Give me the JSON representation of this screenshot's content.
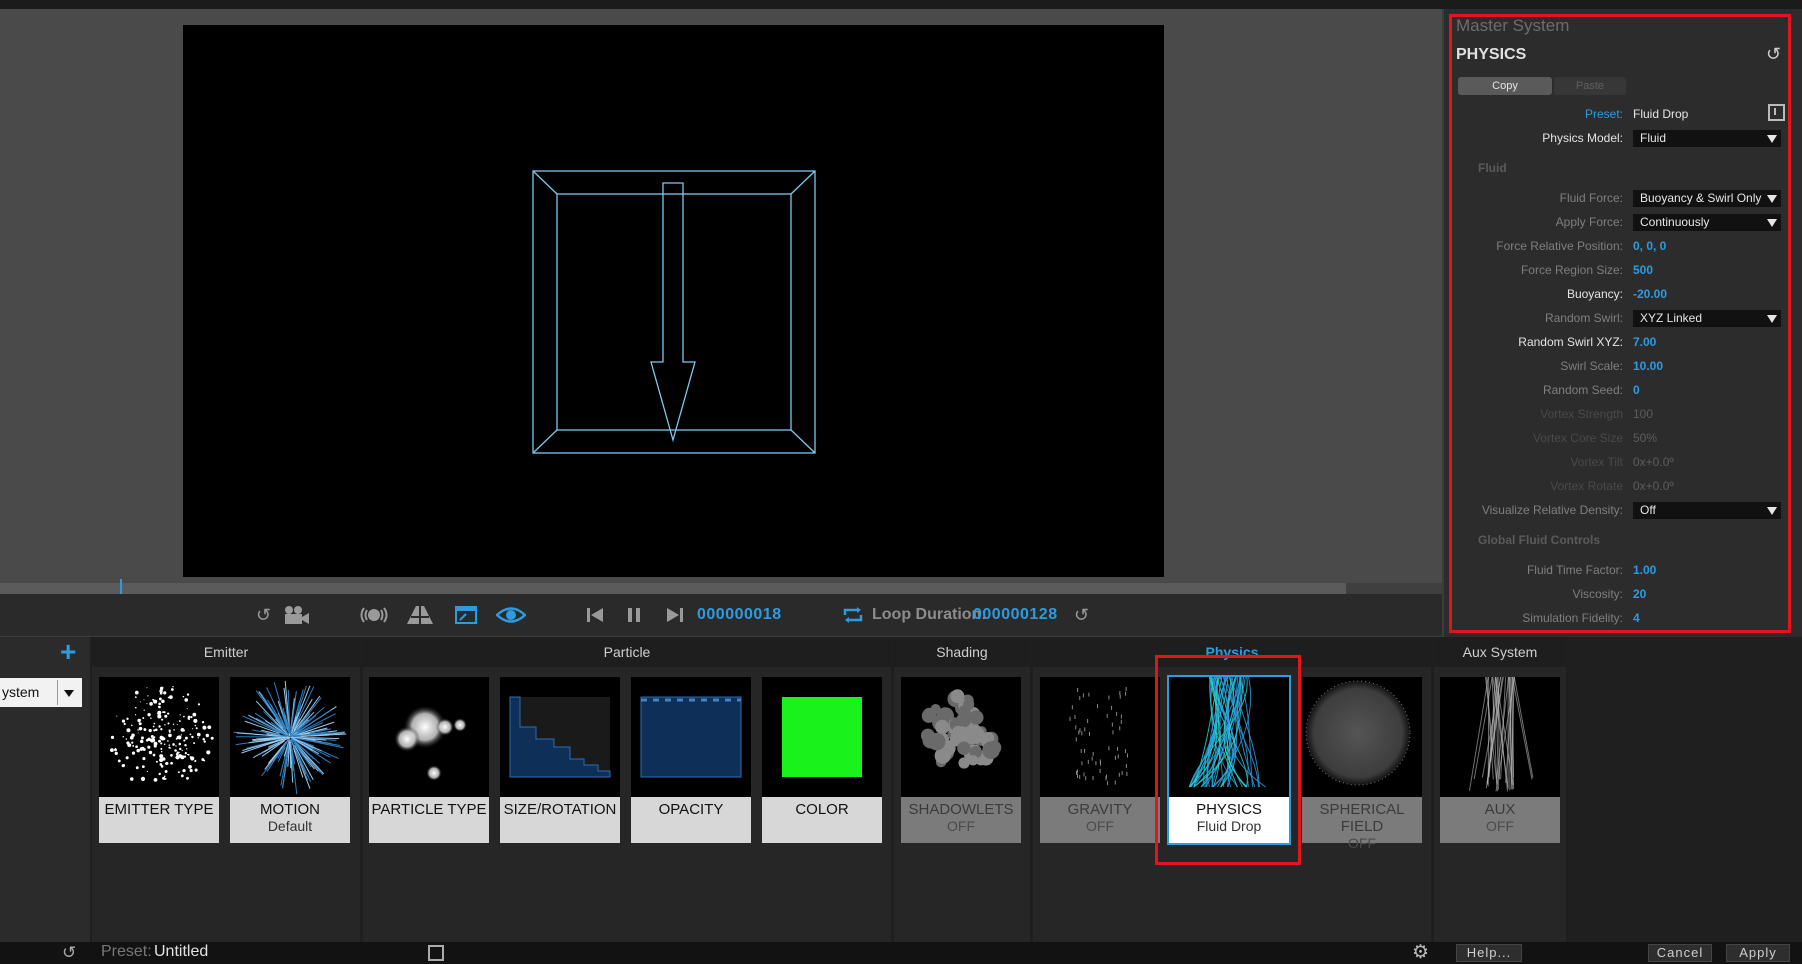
{
  "transport": {
    "current_frame": "000000018",
    "loop_duration_label": "Loop Duration:",
    "loop_duration_value": "000000128"
  },
  "inspector": {
    "system_name": "Master System",
    "section_title": "PHYSICS",
    "copy_label": "Copy",
    "paste_label": "Paste",
    "preset_label": "Preset:",
    "preset_value": "Fluid Drop",
    "physics_model_label": "Physics Model:",
    "physics_model_value": "Fluid",
    "fluid_heading": "Fluid",
    "fluid_force_label": "Fluid Force:",
    "fluid_force_value": "Buoyancy & Swirl Only",
    "apply_force_label": "Apply Force:",
    "apply_force_value": "Continuously",
    "force_rel_pos_label": "Force Relative Position:",
    "force_rel_pos_value": "0, 0, 0",
    "force_region_size_label": "Force Region Size:",
    "force_region_size_value": "500",
    "buoyancy_label": "Buoyancy:",
    "buoyancy_value": "-20.00",
    "random_swirl_label": "Random Swirl:",
    "random_swirl_value": "XYZ Linked",
    "random_swirl_xyz_label": "Random Swirl XYZ:",
    "random_swirl_xyz_value": "7.00",
    "swirl_scale_label": "Swirl Scale:",
    "swirl_scale_value": "10.00",
    "random_seed_label": "Random Seed:",
    "random_seed_value": "0",
    "vortex_strength_label": "Vortex Strength",
    "vortex_strength_value": "100",
    "vortex_core_size_label": "Vortex Core Size",
    "vortex_core_size_value": "50%",
    "vortex_tilt_label": "Vortex Tilt",
    "vortex_tilt_value": "0x+0.0º",
    "vortex_rotate_label": "Vortex Rotate",
    "vortex_rotate_value": "0x+0.0º",
    "visualize_density_label": "Visualize Relative Density:",
    "visualize_density_value": "Off",
    "global_heading": "Global Fluid Controls",
    "fluid_time_factor_label": "Fluid Time Factor:",
    "fluid_time_factor_value": "1.00",
    "viscosity_label": "Viscosity:",
    "viscosity_value": "20",
    "simulation_fidelity_label": "Simulation Fidelity:",
    "simulation_fidelity_value": "4"
  },
  "system_selector": {
    "value": "ystem"
  },
  "groups": {
    "emitter": "Emitter",
    "particle": "Particle",
    "shading": "Shading",
    "physics": "Physics",
    "aux_system": "Aux System"
  },
  "tiles": {
    "emitter_type": {
      "title": "EMITTER TYPE",
      "subtitle": ""
    },
    "motion": {
      "title": "MOTION",
      "subtitle": "Default"
    },
    "particle_type": {
      "title": "PARTICLE TYPE",
      "subtitle": ""
    },
    "size_rotation": {
      "title": "SIZE/ROTATION",
      "subtitle": ""
    },
    "opacity": {
      "title": "OPACITY",
      "subtitle": ""
    },
    "color": {
      "title": "COLOR",
      "subtitle": ""
    },
    "shadowlets": {
      "title": "SHADOWLETS",
      "subtitle": "OFF"
    },
    "gravity": {
      "title": "GRAVITY",
      "subtitle": "OFF"
    },
    "physics": {
      "title": "PHYSICS",
      "subtitle": "Fluid Drop"
    },
    "spherical_field": {
      "title": "SPHERICAL FIELD",
      "subtitle": "OFF"
    },
    "aux": {
      "title": "AUX",
      "subtitle": "OFF"
    }
  },
  "statusbar": {
    "preset_label": "Preset:",
    "preset_value": "Untitled",
    "help_label": "Help...",
    "cancel_label": "Cancel",
    "apply_label": "Apply"
  },
  "colors": {
    "accent": "#2d9be0",
    "highlight_frame": "#e3141c",
    "color_swatch": "#19f21b",
    "opacity_swatch": "#0d2f58"
  }
}
